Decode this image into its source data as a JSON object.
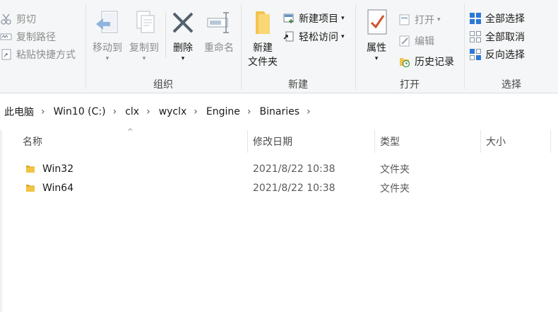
{
  "ribbon": {
    "clipboard": {
      "cut": "剪切",
      "copy_path": "复制路径",
      "paste_shortcut": "粘贴快捷方式"
    },
    "organize": {
      "label": "组织",
      "move_to": "移动到",
      "copy_to": "复制到",
      "delete": "删除",
      "rename": "重命名"
    },
    "new": {
      "label": "新建",
      "new_folder_line1": "新建",
      "new_folder_line2": "文件夹",
      "new_item": "新建项目",
      "easy_access": "轻松访问"
    },
    "open": {
      "label": "打开",
      "properties": "属性",
      "open": "打开",
      "edit": "编辑",
      "history": "历史记录"
    },
    "select": {
      "label": "选择",
      "select_all": "全部选择",
      "select_none": "全部取消",
      "invert": "反向选择"
    }
  },
  "breadcrumb": [
    "此电脑",
    "Win10 (C:)",
    "clx",
    "wyclx",
    "Engine",
    "Binaries"
  ],
  "columns": {
    "name": "名称",
    "modified": "修改日期",
    "type": "类型",
    "size": "大小"
  },
  "files": [
    {
      "name": "Win32",
      "modified": "2021/8/22 10:38",
      "type": "文件夹",
      "size": ""
    },
    {
      "name": "Win64",
      "modified": "2021/8/22 10:38",
      "type": "文件夹",
      "size": ""
    }
  ],
  "colors": {
    "folder": "#e8b53c",
    "accent": "#2b79d6",
    "ribbon_bg": "#f5f6f7",
    "delete_x": "#53606e"
  }
}
